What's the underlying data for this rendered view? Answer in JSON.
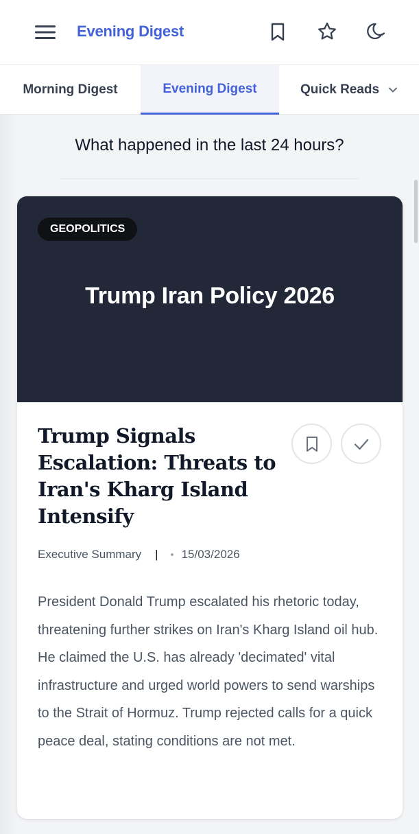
{
  "header": {
    "title": "Evening Digest",
    "icons": [
      "menu-icon",
      "bookmark-icon",
      "star-icon",
      "moon-icon"
    ]
  },
  "tabs": [
    {
      "label": "Morning Digest",
      "active": false
    },
    {
      "label": "Evening Digest",
      "active": true
    },
    {
      "label": "Quick Reads",
      "active": false,
      "has_dropdown": true
    }
  ],
  "question": "What happened in the last 24 hours?",
  "article": {
    "category": "GEOPOLITICS",
    "hero_title": "Trump Iran Policy 2026",
    "headline": "Trump Signals Escalation: Threats to Iran's Kharg Island Intensify",
    "summary_label": "Executive Summary",
    "separator": "|",
    "date": "15/03/2026",
    "body": "President Donald Trump escalated his rhetoric today, threatening further strikes on Iran's Kharg Island oil hub. He claimed the U.S. has already 'decimated' vital infrastructure and urged world powers to send warships to the Strait of Hormuz. Trump rejected calls for a quick peace deal, stating conditions are not met."
  },
  "colors": {
    "accent": "#4361d8",
    "hero_bg": "#222838",
    "pill_bg": "#0f1115",
    "page_bg": "#f3f4f6"
  }
}
